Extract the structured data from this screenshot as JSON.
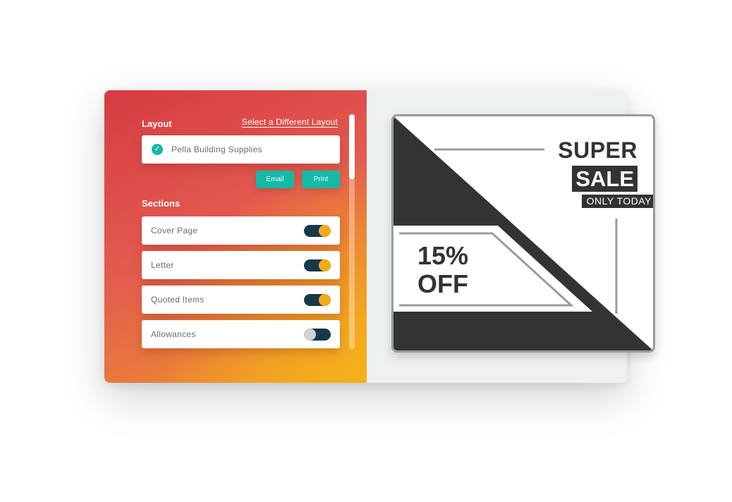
{
  "layout": {
    "title": "Layout",
    "change_link": "Select a Different Layout",
    "selected": "Pella Building Supplies",
    "email_label": "Email",
    "print_label": "Print"
  },
  "sections": {
    "title": "Sections",
    "items": [
      {
        "label": "Cover Page",
        "enabled": true
      },
      {
        "label": "Letter",
        "enabled": true
      },
      {
        "label": "Quoted Items",
        "enabled": true
      },
      {
        "label": "Allowances",
        "enabled": false
      }
    ]
  },
  "preview": {
    "headline": "SUPER",
    "highlight": "SALE",
    "tagline": "ONLY TODAY",
    "discount": "15%",
    "discount_suffix": "OFF"
  },
  "colors": {
    "accent_teal": "#14b9a8",
    "toggle_track": "#16384a",
    "toggle_on_knob": "#f2ab1c",
    "toggle_off_knob": "#cfd3d3",
    "flyer_dark": "#333333"
  }
}
